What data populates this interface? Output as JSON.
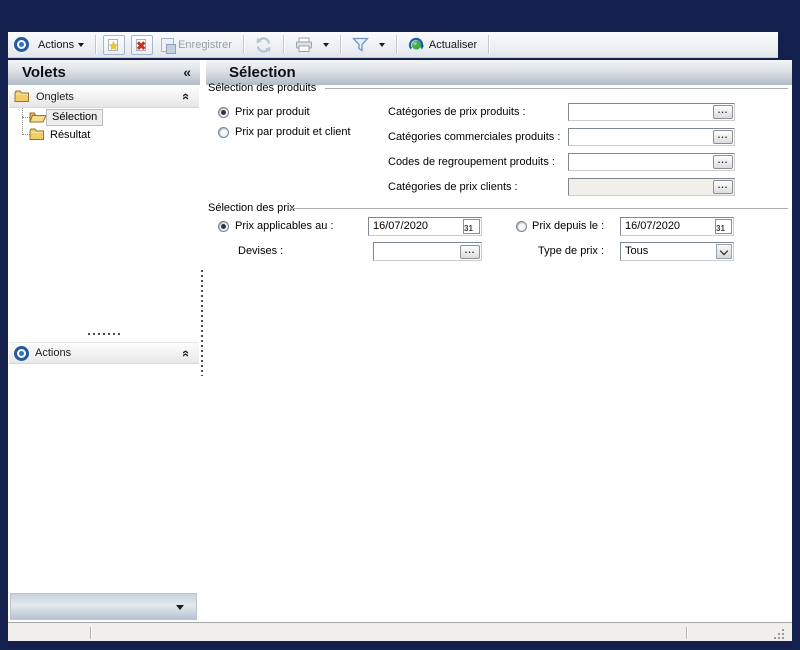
{
  "toolbar": {
    "actions": "Actions",
    "enregistrer": "Enregistrer",
    "actualiser": "Actualiser"
  },
  "sidebar": {
    "title": "Volets",
    "collapse_glyph": "«",
    "panels": {
      "onglets": "Onglets",
      "actions": "Actions"
    },
    "tree": {
      "selection": "Sélection",
      "resultat": "Résultat"
    }
  },
  "main": {
    "title": "Sélection",
    "produits": {
      "label": "Sélection des produits",
      "radio_produit": "Prix par produit",
      "radio_produit_client": "Prix par produit et client",
      "fields": [
        {
          "label": "Catégories de prix produits :",
          "value": ""
        },
        {
          "label": "Catégories commerciales produits :",
          "value": ""
        },
        {
          "label": "Codes de regroupement produits :",
          "value": ""
        },
        {
          "label": "Catégories de prix clients :",
          "value": ""
        }
      ]
    },
    "prix": {
      "label": "Sélection des prix",
      "radio_applicables": "Prix applicables au :",
      "date_applicables": "16/07/2020",
      "radio_depuis": "Prix depuis le :",
      "date_depuis": "16/07/2020",
      "devises_label": "Devises :",
      "devises_value": "",
      "type_label": "Type de prix :",
      "type_value": "Tous"
    }
  },
  "glyphs": {
    "ellipsis": "...",
    "calendar_day": "31"
  },
  "colors": {
    "frame": "#13204e",
    "accent_blue": "#245a9e",
    "green": "#43b046",
    "red": "#c53323",
    "folder_gold": "#f3cd66"
  }
}
